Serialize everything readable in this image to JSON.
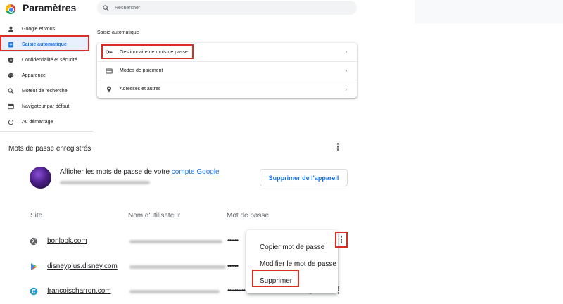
{
  "header": {
    "app_title": "Paramètres",
    "search_placeholder": "Rechercher"
  },
  "sidebar": {
    "items": [
      {
        "label": "Google et vous",
        "icon": "person-icon"
      },
      {
        "label": "Saisie automatique",
        "icon": "assignment-icon",
        "active": true
      },
      {
        "label": "Confidentialité et sécurité",
        "icon": "shield-icon"
      },
      {
        "label": "Apparence",
        "icon": "palette-icon"
      },
      {
        "label": "Moteur de recherche",
        "icon": "search-icon"
      },
      {
        "label": "Navigateur par défaut",
        "icon": "browser-icon"
      },
      {
        "label": "Au démarrage",
        "icon": "power-icon"
      }
    ]
  },
  "autofill": {
    "section_title": "Saisie automatique",
    "rows": [
      {
        "label": "Gestionnaire de mots de passe",
        "icon": "key-icon"
      },
      {
        "label": "Modes de paiement",
        "icon": "credit-card-icon"
      },
      {
        "label": "Adresses et autres",
        "icon": "location-pin-icon"
      }
    ]
  },
  "passwords": {
    "heading": "Mots de passe enregistrés",
    "account_prefix": "Afficher les mots de passe de votre ",
    "account_link": "compte Google",
    "remove_device_label": "Supprimer de l'appareil",
    "columns": {
      "site": "Site",
      "username": "Nom d'utilisateur",
      "password": "Mot de passe"
    },
    "rows": [
      {
        "site": "bonlook.com",
        "icon": "globe-icon",
        "password_mask": "••••••"
      },
      {
        "site": "disneyplus.disney.com",
        "icon": "google-play-icon",
        "password_mask": "••••••"
      },
      {
        "site": "francoischarron.com",
        "icon": "site-favicon-icon",
        "password_mask": "••••••••••"
      }
    ]
  },
  "context_menu": {
    "items": [
      "Copier mot de passe",
      "Modifier le mot de passe",
      "Supprimer"
    ]
  },
  "colors": {
    "accent": "#1a73e8",
    "highlight": "#d93025",
    "active_nav_bg": "#e8f0fe"
  }
}
